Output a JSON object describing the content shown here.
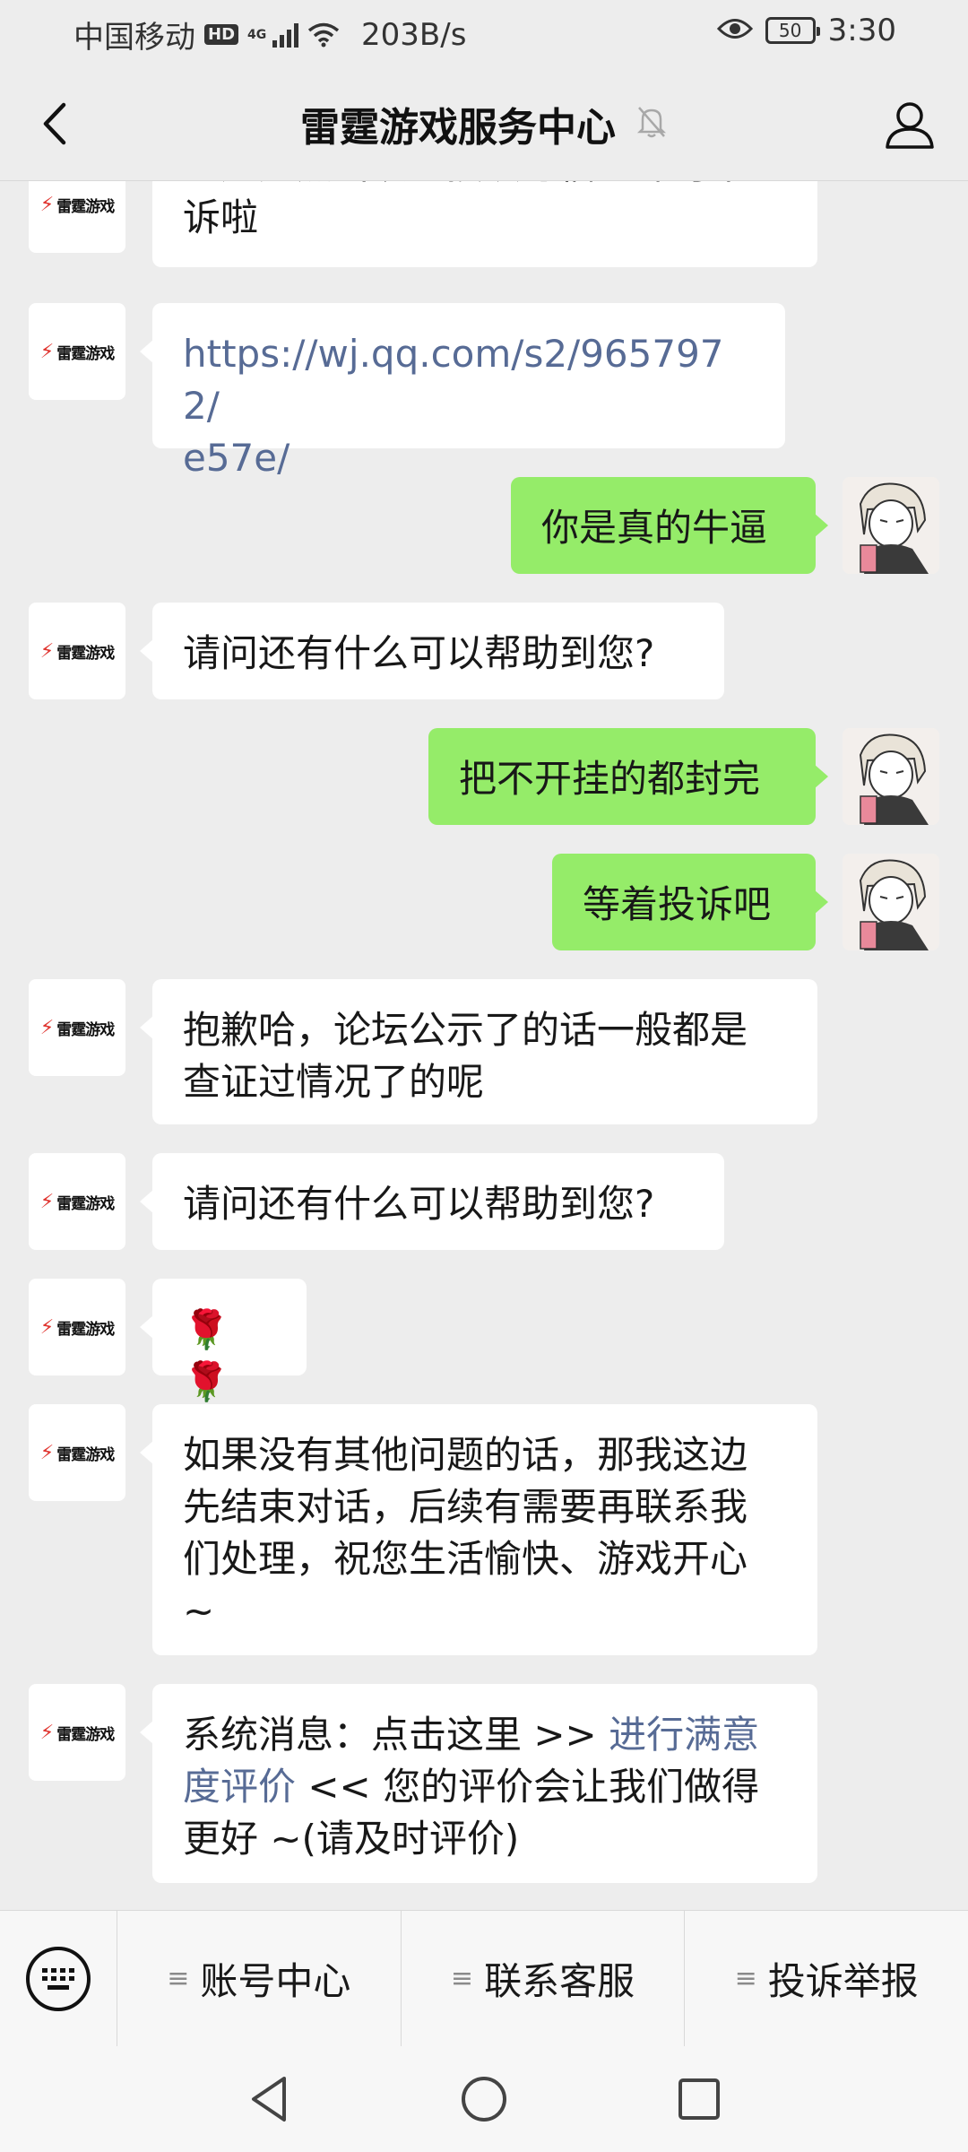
{
  "status_bar": {
    "carrier": "中国移动",
    "hd": "HD",
    "network": "4G",
    "speed": "203B/s",
    "battery": "50",
    "time": "3:30"
  },
  "header": {
    "title": "雷霆游戏服务中心",
    "back_icon": "chevron-left-icon",
    "mute_icon": "bell-muted-icon",
    "profile_icon": "person-icon"
  },
  "brand_avatar": {
    "bolt": "⚡",
    "label": "雷霆游戏"
  },
  "messages": [
    {
      "side": "in",
      "line1": "您还是点击该链接填写信息即可申",
      "line2": "诉啦"
    },
    {
      "side": "in",
      "line1": "https://wj.qq.com/s2/9657972/",
      "line2": "e57e/"
    },
    {
      "side": "out",
      "text": "你是真的牛逼"
    },
    {
      "side": "in",
      "text": "请问还有什么可以帮助到您?"
    },
    {
      "side": "out",
      "text": "把不开挂的都封完"
    },
    {
      "side": "out",
      "text": "等着投诉吧"
    },
    {
      "side": "in",
      "line1": "抱歉哈，论坛公示了的话一般都是",
      "line2": "查证过情况了的呢"
    },
    {
      "side": "in",
      "text": "请问还有什么可以帮助到您?"
    },
    {
      "side": "in",
      "text": "🌹🌹"
    },
    {
      "side": "in",
      "line1": "如果没有其他问题的话，那我这边",
      "line2": "先结束对话，后续有需要再联系我",
      "line3": "们处理，祝您生活愉快、游戏开心",
      "line4": "~"
    },
    {
      "side": "in",
      "prefix": "系统消息：点击这里 >> ",
      "link1": "进行满意",
      "link2": "度评价",
      "suffix": " << 您的评价会让我们做得",
      "line3": "更好 ~(请及时评价)"
    }
  ],
  "menu": {
    "keyboard_icon": "keyboard-icon",
    "items": [
      {
        "icon": "≡",
        "label": "账号中心"
      },
      {
        "icon": "≡",
        "label": "联系客服"
      },
      {
        "icon": "≡",
        "label": "投诉举报"
      }
    ]
  },
  "nav": {
    "back": "triangle-back-icon",
    "home": "circle-home-icon",
    "recents": "square-recents-icon"
  }
}
